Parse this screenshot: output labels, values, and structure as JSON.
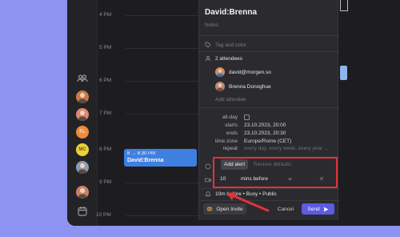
{
  "calendar": {
    "hours": [
      "4 PM",
      "5 PM",
      "6 PM",
      "7 PM",
      "8 PM",
      "9 PM",
      "10 PM"
    ],
    "event": {
      "time": "8 → 8:30 PM",
      "name": "David:Brenna",
      "color": "#3f7fe0"
    }
  },
  "sidebar": {
    "avatars": [
      {
        "initials": "",
        "color": "#c97a4a"
      },
      {
        "initials": "",
        "color": "#d98a70"
      },
      {
        "initials": "FL",
        "color": "#f08a3a"
      },
      {
        "initials": "MC",
        "color": "#e9d23a"
      },
      {
        "initials": "",
        "color": "#8a9bb0"
      },
      {
        "initials": "",
        "color": "#c9806a"
      }
    ]
  },
  "popover": {
    "title": "David:Brenna",
    "notes_placeholder": "Notes",
    "tag_placeholder": "Tag and color",
    "attendees_summary": "2 attendees",
    "attendees": [
      "david@morgen.so",
      "Brenna Donoghue"
    ],
    "add_attendee_placeholder": "Add attendee",
    "fields": {
      "allday_label": "all-day",
      "starts_label": "starts",
      "starts_value": "23.10.2023, 20:00",
      "ends_label": "ends",
      "ends_value": "23.10.2023, 20:30",
      "timezone_label": "time zone",
      "timezone_value": "Europe/Rome (CET)",
      "repeat_label": "repeat",
      "repeat_value": "every day, every week, every year ..."
    },
    "alert": {
      "add_label": "Add alert",
      "restore_label": "Restore defaults",
      "amount": "10",
      "unit": "mins before"
    },
    "summary_line": "10m before • Busy • Public",
    "open_invite_label": "Open Invite",
    "cancel_label": "Cancel",
    "send_label": "Send",
    "send_color": "#5b5ce0"
  },
  "accent": {
    "highlight": "#e0333a",
    "background": "#8d93f0"
  }
}
